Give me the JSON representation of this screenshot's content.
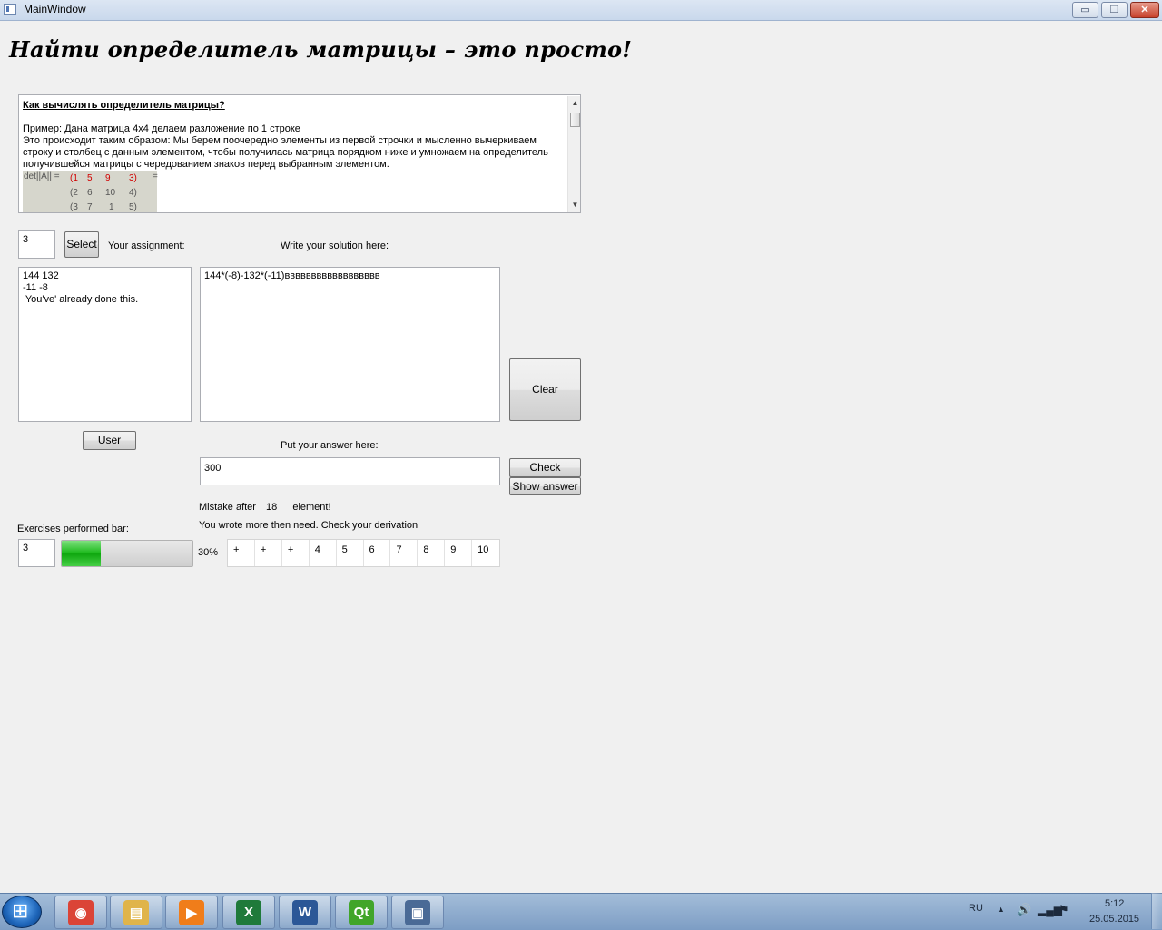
{
  "window": {
    "title": "MainWindow",
    "minimize_glyph": "▭",
    "maximize_glyph": "❐",
    "close_glyph": "✕"
  },
  "heading": "Найти определитель матрицы – это просто!",
  "help": {
    "title": "Как вычислять определитель матрицы?",
    "example": "Пример: Дана матрица 4х4 делаем разложение по 1 строке",
    "body": "Это происходит таким образом: Мы берем поочередно элементы из первой строчки и мысленно вычеркиваем строку и столбец с данным элементом, чтобы получилась матрица порядком ниже и умножаем на определитель получившейся матрицы с чередованием знаков перед выбранным элементом.",
    "det_label": "det||A|| =",
    "equals": "=",
    "matrix_rows": [
      [
        "(1",
        "5",
        "9",
        "3)"
      ],
      [
        "(2",
        "6",
        "10",
        "4)"
      ],
      [
        "(3",
        "7",
        "1",
        "5)"
      ]
    ],
    "scroll_up": "▲",
    "scroll_down": "▼"
  },
  "controls": {
    "variant_value": "3",
    "select_label": "Select",
    "assignment_label": "Your assignment:",
    "solution_label": "Write your solution here:",
    "assignment_lines": [
      "144 132",
      "-11 -8",
      " You've' already done this."
    ],
    "solution_text": "144*(-8)-132*(-11)вввввввввввввввввв",
    "clear_label": "Clear",
    "user_label": "User",
    "answer_label": "Put your answer here:",
    "answer_value": "300",
    "check_label": "Check",
    "show_answer_label": "Show answer"
  },
  "status": {
    "mistake_prefix": "Mistake after",
    "mistake_index": "18",
    "mistake_suffix": "element!",
    "wrote_message": "You wrote more then need. Check your derivation",
    "exercises_label": "Exercises performed bar:",
    "done_count": "3",
    "progress_percent": 30,
    "progress_text": "30%",
    "cells": [
      "+",
      "+",
      "+",
      "4",
      "5",
      "6",
      "7",
      "8",
      "9",
      "10"
    ]
  },
  "taskbar": {
    "apps": [
      {
        "name": "chrome",
        "glyph": "◉",
        "color": "#db4437"
      },
      {
        "name": "explorer",
        "glyph": "▤",
        "color": "#e0b44a"
      },
      {
        "name": "media-player",
        "glyph": "▶",
        "color": "#f07d1a"
      },
      {
        "name": "excel",
        "glyph": "X",
        "color": "#1f7a3a"
      },
      {
        "name": "word",
        "glyph": "W",
        "color": "#2b5797"
      },
      {
        "name": "qt-creator",
        "glyph": "Qt",
        "color": "#41a52a"
      },
      {
        "name": "app-window",
        "glyph": "▣",
        "color": "#4a6a96"
      }
    ],
    "language": "RU",
    "tray_up": "▲",
    "tray_sound": "🔊",
    "tray_network": "▂▄▆",
    "tray_flag": "⚑",
    "time": "5:12",
    "date": "25.05.2015"
  }
}
